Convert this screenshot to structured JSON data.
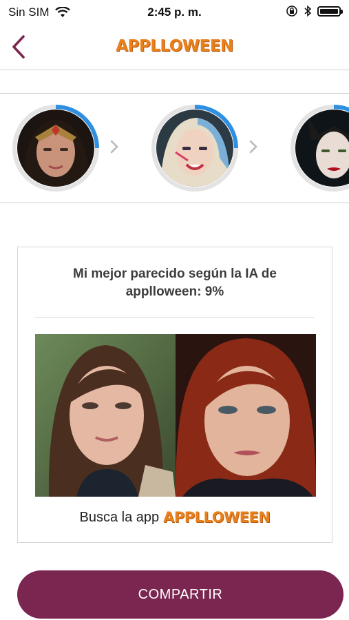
{
  "status_bar": {
    "carrier": "Sin SIM",
    "time": "2:45 p. m."
  },
  "header": {
    "logo_text": "APPLLOWEEN"
  },
  "carousel": {
    "items": [
      {
        "name": "wonder-woman",
        "progress": 0.25
      },
      {
        "name": "harley-quinn",
        "progress": 0.25
      },
      {
        "name": "maleficent",
        "progress": 0.25
      }
    ]
  },
  "result": {
    "line1": "Mi mejor parecido según la IA de",
    "line2": "applloween:   9%",
    "busca_label": "Busca la app",
    "busca_logo": "APPLLOWEEN"
  },
  "share_button": "COMPARTIR",
  "colors": {
    "brand_purple": "#7a2651",
    "logo_orange": "#e8801c",
    "ring_blue": "#2f8fe0"
  }
}
